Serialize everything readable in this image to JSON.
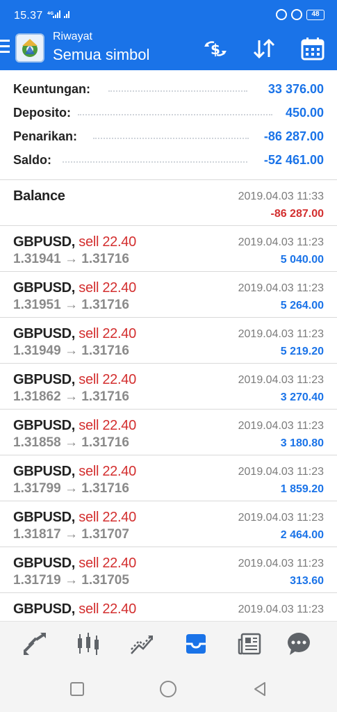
{
  "status": {
    "time": "15.37",
    "signal": "4G",
    "battery": "48"
  },
  "header": {
    "subtitle": "Riwayat",
    "title": "Semua simbol",
    "icons": [
      "menu-icon",
      "metatrader-logo",
      "currency-exchange-icon",
      "sort-icon",
      "calendar-icon"
    ]
  },
  "summary": [
    {
      "label": "Keuntungan:",
      "value": "33 376.00"
    },
    {
      "label": "Deposito:",
      "value": "450.00"
    },
    {
      "label": "Penarikan:",
      "value": "-86 287.00"
    },
    {
      "label": "Saldo:",
      "value": "-52 461.00"
    }
  ],
  "history": [
    {
      "symbol": "Balance",
      "side": "",
      "open": "",
      "close": "",
      "datetime": "2019.04.03 11:33",
      "profit": "-86 287.00"
    },
    {
      "symbol": "GBPUSD,",
      "side": "sell 22.40",
      "open": "1.31941",
      "close": "1.31716",
      "datetime": "2019.04.03 11:23",
      "profit": "5 040.00"
    },
    {
      "symbol": "GBPUSD,",
      "side": "sell 22.40",
      "open": "1.31951",
      "close": "1.31716",
      "datetime": "2019.04.03 11:23",
      "profit": "5 264.00"
    },
    {
      "symbol": "GBPUSD,",
      "side": "sell 22.40",
      "open": "1.31949",
      "close": "1.31716",
      "datetime": "2019.04.03 11:23",
      "profit": "5 219.20"
    },
    {
      "symbol": "GBPUSD,",
      "side": "sell 22.40",
      "open": "1.31862",
      "close": "1.31716",
      "datetime": "2019.04.03 11:23",
      "profit": "3 270.40"
    },
    {
      "symbol": "GBPUSD,",
      "side": "sell 22.40",
      "open": "1.31858",
      "close": "1.31716",
      "datetime": "2019.04.03 11:23",
      "profit": "3 180.80"
    },
    {
      "symbol": "GBPUSD,",
      "side": "sell 22.40",
      "open": "1.31799",
      "close": "1.31716",
      "datetime": "2019.04.03 11:23",
      "profit": "1 859.20"
    },
    {
      "symbol": "GBPUSD,",
      "side": "sell 22.40",
      "open": "1.31817",
      "close": "1.31707",
      "datetime": "2019.04.03 11:23",
      "profit": "2 464.00"
    },
    {
      "symbol": "GBPUSD,",
      "side": "sell 22.40",
      "open": "1.31719",
      "close": "1.31705",
      "datetime": "2019.04.03 11:23",
      "profit": "313.60"
    },
    {
      "symbol": "GBPUSD,",
      "side": "sell 22.40",
      "open": "",
      "close": "",
      "datetime": "2019.04.03 11:23",
      "profit": ""
    }
  ],
  "arrow": "→",
  "tabs": [
    {
      "icon": "quotes-icon",
      "active": false
    },
    {
      "icon": "chart-icon",
      "active": false
    },
    {
      "icon": "trade-icon",
      "active": false
    },
    {
      "icon": "history-icon",
      "active": true
    },
    {
      "icon": "news-icon",
      "active": false
    },
    {
      "icon": "messages-icon",
      "active": false
    }
  ],
  "nav": [
    "recents-icon",
    "home-icon",
    "back-icon"
  ],
  "colors": {
    "primary": "#1a73e8",
    "negative": "#d32f2f",
    "muted": "#8a8a8a",
    "tab_inactive": "#5f6368"
  }
}
